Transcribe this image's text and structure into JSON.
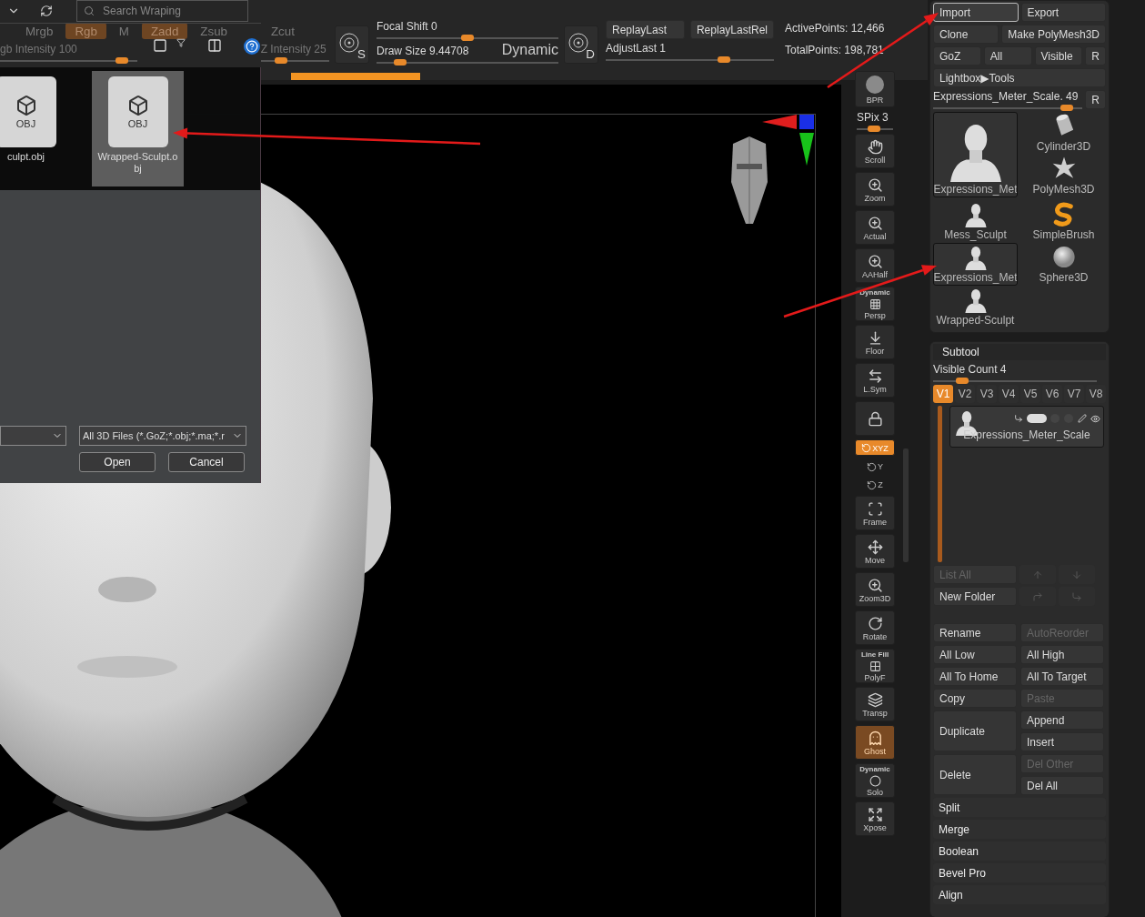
{
  "dialog": {
    "search": {
      "placeholder": "Search Wraping"
    },
    "files": [
      {
        "name": "culpt.obj",
        "type": "OBJ",
        "selected": false
      },
      {
        "name": "Wrapped-Sculpt.obj",
        "type": "OBJ",
        "selected": true
      }
    ],
    "filter": "All 3D Files (*.GoZ;*.obj;*.ma;*.r",
    "buttons": [
      "Open",
      "Cancel"
    ]
  },
  "top_bar": {
    "mode_buttons": [
      {
        "label": "Mrgb",
        "on": false
      },
      {
        "label": "Rgb",
        "on": true
      },
      {
        "label": "M",
        "on": false
      },
      {
        "label": "Zadd",
        "on": true
      },
      {
        "label": "Zsub",
        "on": false
      },
      {
        "label": "Zcut",
        "on": false
      }
    ],
    "intensity_sliders": [
      {
        "label": "gb Intensity 100",
        "level": 0.93
      },
      {
        "label": "Z Intensity 25",
        "level": 0.25
      }
    ],
    "brush": {
      "letter": "S",
      "sliders": [
        {
          "label": "Focal Shift 0",
          "level": 0.5
        },
        {
          "label": "Draw Size 9.44708",
          "level": 0.1
        }
      ],
      "dynamic": "Dynamic"
    },
    "replay": {
      "letter": "D",
      "buttons": [
        "ReplayLast",
        "ReplayLastRel"
      ],
      "slider": {
        "label": "AdjustLast 1",
        "level": 0.72
      }
    },
    "stats": [
      "ActivePoints: 12,466",
      "TotalPoints: 198,781"
    ]
  },
  "toolbar": [
    {
      "kind": "button",
      "label": "BPR",
      "on": false
    },
    {
      "kind": "slider",
      "label": "SPix 3",
      "level": 0.45
    },
    {
      "kind": "button",
      "label": "Scroll",
      "on": false
    },
    {
      "kind": "button",
      "label": "Zoom",
      "on": false
    },
    {
      "kind": "button",
      "label": "Actual",
      "on": false
    },
    {
      "kind": "button",
      "label": "AAHalf",
      "on": false
    },
    {
      "kind": "button",
      "label": "Persp",
      "caption": "Dynamic",
      "on": false
    },
    {
      "kind": "button",
      "label": "Floor",
      "on": false
    },
    {
      "kind": "button",
      "label": "L.Sym",
      "on": false
    },
    {
      "kind": "icon",
      "on": false
    },
    {
      "kind": "small",
      "label": "XYZ",
      "on": true
    },
    {
      "kind": "tiny",
      "label": "Y",
      "on": false
    },
    {
      "kind": "tiny",
      "label": "Z",
      "on": false
    },
    {
      "kind": "button",
      "label": "Frame",
      "on": false
    },
    {
      "kind": "button",
      "label": "Move",
      "on": false
    },
    {
      "kind": "button",
      "label": "Zoom3D",
      "on": false
    },
    {
      "kind": "button",
      "label": "Rotate",
      "on": false
    },
    {
      "kind": "button",
      "label": "PolyF",
      "caption": "Line Fill",
      "on": false
    },
    {
      "kind": "button",
      "label": "Transp",
      "on": false
    },
    {
      "kind": "button",
      "label": "Ghost",
      "on": true
    },
    {
      "kind": "button",
      "label": "Solo",
      "caption": "Dynamic",
      "on": false
    },
    {
      "kind": "button",
      "label": "Xpose",
      "on": false
    }
  ],
  "tool_panel": {
    "rows": [
      [
        {
          "label": "Import",
          "selected": true
        },
        {
          "label": "Export",
          "selected": false
        }
      ],
      [
        {
          "label": "Clone",
          "selected": false
        },
        {
          "label": "Make PolyMesh3D",
          "selected": false
        }
      ],
      [
        {
          "label": "GoZ",
          "selected": false
        },
        {
          "label": "All",
          "selected": false
        },
        {
          "label": "Visible",
          "selected": false
        },
        {
          "label": "R",
          "selected": false
        }
      ],
      [
        {
          "label": "Lightbox▶Tools",
          "selected": false
        }
      ]
    ],
    "scale_slider": {
      "label": "Expressions_Meter_Scale. 49",
      "level": 0.93,
      "reset": "R"
    },
    "featured": {
      "label": "Expressions_Met",
      "kind": "bust",
      "selected": true
    },
    "featured_side": [
      {
        "label": "Cylinder3D",
        "kind": "cylinder",
        "selected": false
      },
      {
        "label": "PolyMesh3D",
        "kind": "star",
        "selected": false
      }
    ],
    "tools": [
      {
        "label": "Mess_Sculpt",
        "kind": "bust",
        "selected": false
      },
      {
        "label": "SimpleBrush",
        "kind": "brush",
        "selected": false
      },
      {
        "label": "Expressions_Met",
        "kind": "bust",
        "selected": true
      },
      {
        "label": "Sphere3D",
        "kind": "sphere",
        "selected": false
      },
      {
        "label": "Wrapped-Sculpt",
        "kind": "bust",
        "selected": false
      }
    ]
  },
  "subtool": {
    "title": "Subtool",
    "visible_count": {
      "label": "Visible Count 4",
      "level": 0.15
    },
    "versions": [
      {
        "label": "V1",
        "selected": true
      },
      {
        "label": "V2",
        "selected": false
      },
      {
        "label": "V3",
        "selected": false
      },
      {
        "label": "V4",
        "selected": false
      },
      {
        "label": "V5",
        "selected": false
      },
      {
        "label": "V6",
        "selected": false
      },
      {
        "label": "V7",
        "selected": false
      },
      {
        "label": "V8",
        "selected": false
      }
    ],
    "items": [
      {
        "name": "Expressions_Meter_Scale",
        "selected": true
      }
    ],
    "list_all": {
      "label": "List All",
      "disabled": true
    },
    "new_folder": {
      "label": "New Folder",
      "disabled": false
    },
    "button_rows": [
      {
        "left": {
          "label": "Rename",
          "disabled": false
        },
        "right": [
          {
            "label": "AutoReorder",
            "disabled": true
          }
        ]
      },
      {
        "left": {
          "label": "All Low",
          "disabled": false
        },
        "right": [
          {
            "label": "All High",
            "disabled": false
          }
        ]
      },
      {
        "left": {
          "label": "All To Home",
          "disabled": false
        },
        "right": [
          {
            "label": "All To Target",
            "disabled": false
          }
        ]
      },
      {
        "left": {
          "label": "Copy",
          "disabled": false
        },
        "right": [
          {
            "label": "Paste",
            "disabled": true
          }
        ]
      },
      {
        "left": {
          "label": "Duplicate",
          "disabled": false
        },
        "right": [
          {
            "label": "Append",
            "disabled": false
          },
          {
            "label": "Insert",
            "disabled": false
          }
        ]
      },
      {
        "left": {
          "label": "Delete",
          "disabled": false
        },
        "right": [
          {
            "label": "Del Other",
            "disabled": true
          },
          {
            "label": "Del All",
            "disabled": false
          }
        ]
      }
    ],
    "sections": [
      "Split",
      "Merge",
      "Boolean",
      "Bevel Pro",
      "Align"
    ]
  }
}
